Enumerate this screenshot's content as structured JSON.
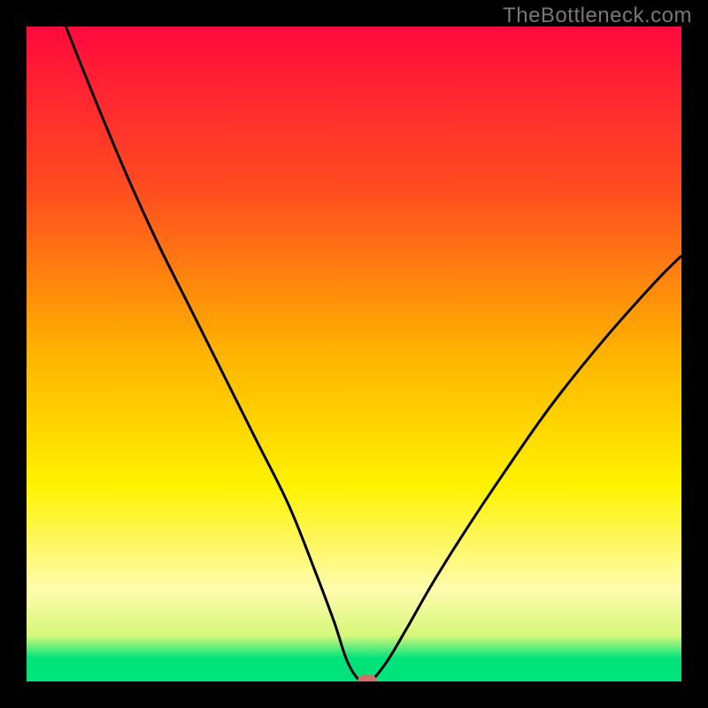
{
  "watermark": "TheBottleneck.com",
  "colors": {
    "black": "#000000",
    "red_top": "#ff0a3d",
    "orange": "#ff8a00",
    "yellow": "#fff200",
    "pale_yellow": "#fffc9a",
    "green_band": "#00e27a",
    "marker": "#d47067",
    "curve": "#000000",
    "watermark": "#777777"
  },
  "chart_data": {
    "type": "line",
    "title": "",
    "xlabel": "",
    "ylabel": "",
    "xlim": [
      0,
      100
    ],
    "ylim": [
      0,
      100
    ],
    "note": "V-shaped bottleneck curve on red-to-green gradient. Values estimated from pixel positions (no axis ticks visible).",
    "series": [
      {
        "name": "bottleneck-curve",
        "x": [
          6,
          10,
          15,
          20,
          25,
          30,
          35,
          40,
          44,
          47,
          49,
          51,
          52.5,
          55,
          58,
          62,
          67,
          73,
          80,
          88,
          96,
          100
        ],
        "y": [
          100,
          90,
          78,
          67,
          57,
          47,
          37,
          27,
          17,
          9,
          3,
          0,
          0,
          3,
          8,
          15,
          23,
          32,
          42,
          52,
          61,
          65
        ]
      }
    ],
    "marker_point": {
      "x": 52,
      "y": 0
    },
    "gradient_stops": [
      {
        "pos": 0.0,
        "color": "#ff0a3d"
      },
      {
        "pos": 0.25,
        "color": "#ff4d1f"
      },
      {
        "pos": 0.5,
        "color": "#ffb300"
      },
      {
        "pos": 0.7,
        "color": "#fff200"
      },
      {
        "pos": 0.86,
        "color": "#fffcae"
      },
      {
        "pos": 0.93,
        "color": "#d6f77a"
      },
      {
        "pos": 0.965,
        "color": "#00e27a"
      },
      {
        "pos": 1.0,
        "color": "#00e27a"
      }
    ]
  }
}
